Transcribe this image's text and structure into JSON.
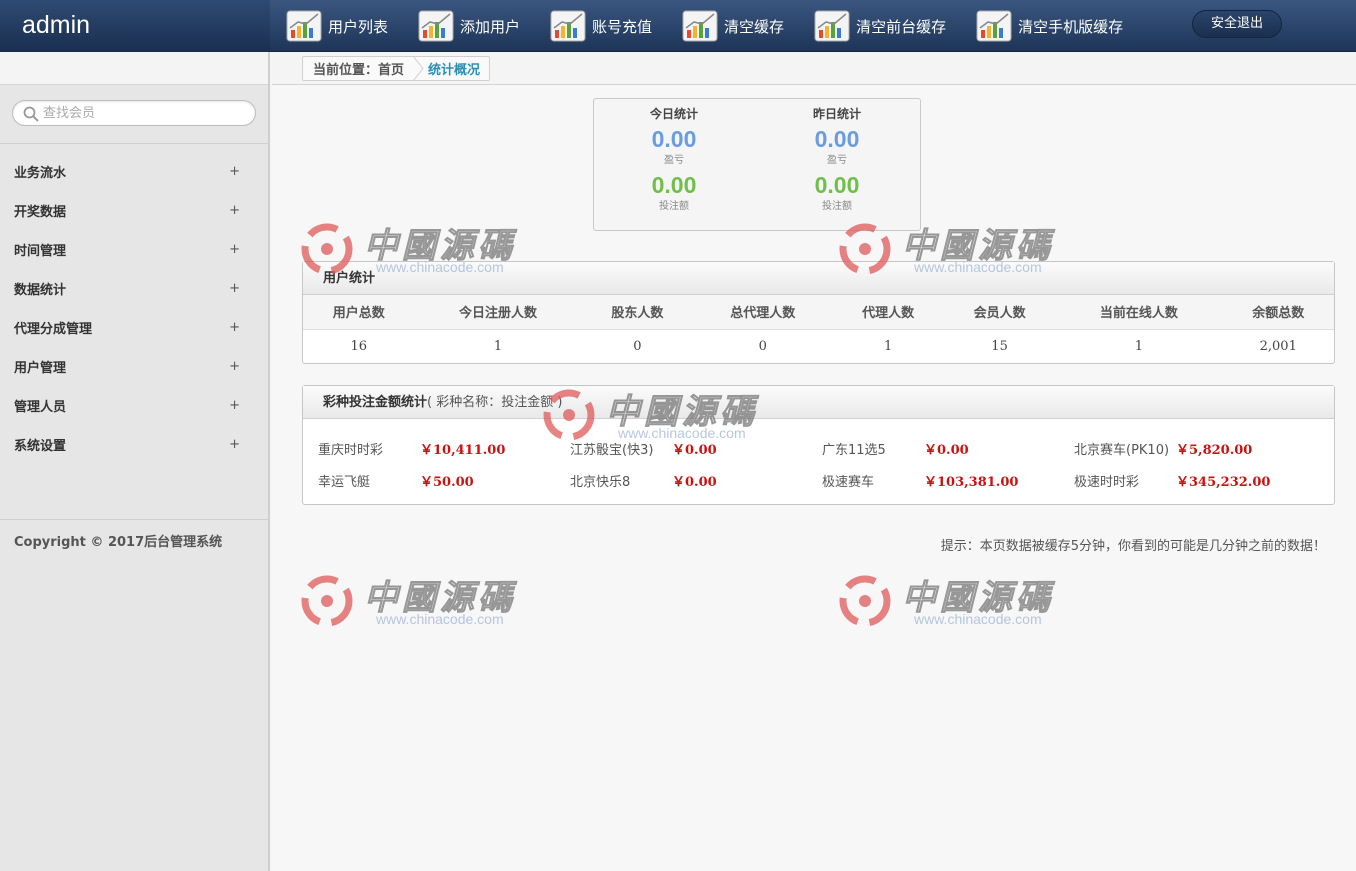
{
  "brand": "admin",
  "topnav": [
    {
      "label": "用户列表",
      "icon": "chart-icon"
    },
    {
      "label": "添加用户",
      "icon": "chart-icon"
    },
    {
      "label": "账号充值",
      "icon": "chart-icon"
    },
    {
      "label": "清空缓存",
      "icon": "chart-icon"
    },
    {
      "label": "清空前台缓存",
      "icon": "chart-icon"
    },
    {
      "label": "清空手机版缓存",
      "icon": "chart-icon"
    }
  ],
  "logout_label": "安全退出",
  "search": {
    "placeholder": "查找会员",
    "value": ""
  },
  "menu": [
    {
      "label": "业务流水",
      "toggle": "+"
    },
    {
      "label": "开奖数据",
      "toggle": "+"
    },
    {
      "label": "时间管理",
      "toggle": "+"
    },
    {
      "label": "数据统计",
      "toggle": "+"
    },
    {
      "label": "代理分成管理",
      "toggle": "+"
    },
    {
      "label": "用户管理",
      "toggle": "+"
    },
    {
      "label": "管理人员",
      "toggle": "+"
    },
    {
      "label": "系统设置",
      "toggle": "+"
    }
  ],
  "copyright": "Copyright © 2017后台管理系统",
  "breadcrumb": {
    "prefix": "当前位置：首页",
    "current": "统计概况"
  },
  "stats": {
    "today": {
      "title": "今日统计",
      "profit": "0.00",
      "profit_label": "盈亏",
      "bet": "0.00",
      "bet_label": "投注额"
    },
    "yesterday": {
      "title": "昨日统计",
      "profit": "0.00",
      "profit_label": "盈亏",
      "bet": "0.00",
      "bet_label": "投注额"
    }
  },
  "user_stats": {
    "title": "用户统计",
    "headers": [
      "用户总数",
      "今日注册人数",
      "股东人数",
      "总代理人数",
      "代理人数",
      "会员人数",
      "当前在线人数",
      "余额总数"
    ],
    "values": [
      "16",
      "1",
      "0",
      "0",
      "1",
      "15",
      "1",
      "2,001"
    ]
  },
  "lottery": {
    "title": "彩种投注金额统计",
    "subtitle": "( 彩种名称：投注金额 )",
    "rows": [
      [
        {
          "name": "重庆时时彩",
          "amount": "￥10,411.00"
        },
        {
          "name": "江苏骰宝(快3)",
          "amount": "￥0.00"
        },
        {
          "name": "广东11选5",
          "amount": "￥0.00"
        },
        {
          "name": "北京赛车(PK10)",
          "amount": "￥5,820.00"
        }
      ],
      [
        {
          "name": "幸运飞艇",
          "amount": "￥50.00"
        },
        {
          "name": "北京快乐8",
          "amount": "￥0.00"
        },
        {
          "name": "极速赛车",
          "amount": "￥103,381.00"
        },
        {
          "name": "极速时时彩",
          "amount": "￥345,232.00"
        }
      ]
    ]
  },
  "tip": "提示：本页数据被缓存5分钟，你看到的可能是几分钟之前的数据！",
  "watermark": {
    "text": "中國源碼",
    "url": "www.chinacode.com"
  },
  "colors": {
    "profit": "#6b9be0",
    "bet": "#6fbf4a",
    "amount": "#cc1111",
    "header": "#1e3558"
  }
}
